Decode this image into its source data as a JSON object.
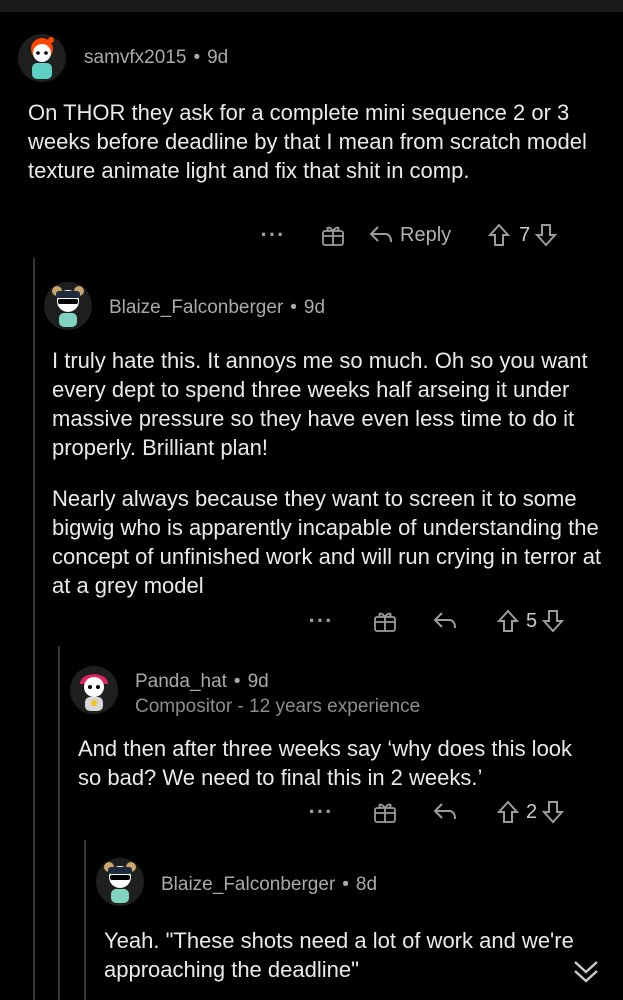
{
  "comments": [
    {
      "username": "samvfx2015",
      "time": "9d",
      "flair": "",
      "paragraphs": [
        "On THOR they ask for a complete mini sequence 2 or 3 weeks before deadline by that I mean from scratch model texture animate light and fix that shit in comp."
      ],
      "reply_label": "Reply",
      "votes": "7",
      "avatar_colors": {
        "head": "#ff4500",
        "face": "#ffffff",
        "body": "#5fd1c4"
      }
    },
    {
      "username": "Blaize_Falconberger",
      "time": "9d",
      "flair": "",
      "paragraphs": [
        "I truly hate this. It annoys me so much. Oh so you want every dept to spend three weeks half arseing it under massive pressure so they have even less time to do it properly. Brilliant plan!",
        "Nearly always because they want to screen it to some bigwig who is apparently incapable of understanding the concept of unfinished work and will run crying in terror at at a grey model"
      ],
      "reply_label": "",
      "votes": "5",
      "avatar_colors": {
        "head": "#c9a56b",
        "face": "#ffffff",
        "body": "#7fd3c0"
      }
    },
    {
      "username": "Panda_hat",
      "time": "9d",
      "flair": "Compositor - 12 years experience",
      "paragraphs": [
        "And then after three weeks say ‘why does this look so bad? We need to final this in 2 weeks.’"
      ],
      "reply_label": "",
      "votes": "2",
      "avatar_colors": {
        "head": "#e0245e",
        "face": "#ffffff",
        "body": "#d7d7d7"
      }
    },
    {
      "username": "Blaize_Falconberger",
      "time": "8d",
      "flair": "",
      "paragraphs": [
        "Yeah. \"These shots need a lot of work and we're approaching the deadline\""
      ],
      "reply_label": "",
      "votes": "",
      "avatar_colors": {
        "head": "#c9a56b",
        "face": "#ffffff",
        "body": "#7fd3c0"
      }
    }
  ],
  "icons": {
    "more": "more-options-icon",
    "award": "award-gift-icon",
    "reply": "reply-arrow-icon",
    "upvote": "upvote-arrow-icon",
    "downvote": "downvote-arrow-icon",
    "collapse": "double-chevron-down-icon"
  },
  "colors": {
    "background": "#000000",
    "text": "#e8eaec",
    "meta": "#a8aaab",
    "thread_line": "#343536"
  }
}
